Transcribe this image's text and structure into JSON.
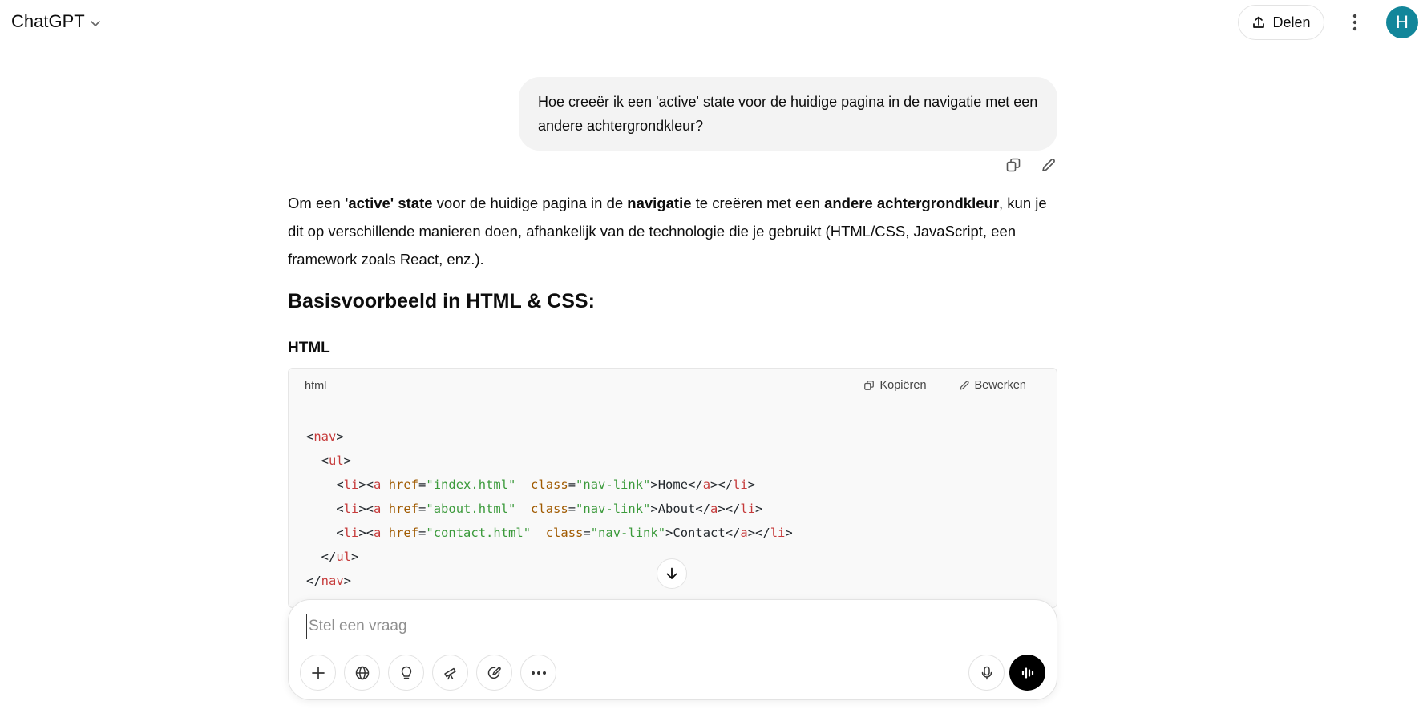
{
  "header": {
    "model_title": "ChatGPT",
    "share_label": "Delen",
    "avatar_initial": "H"
  },
  "user_message": {
    "text": "Hoe creeër ik een 'active' state voor de huidige pagina in de navigatie met een andere achtergrondkleur?"
  },
  "assistant": {
    "intro": {
      "t1": "Om een ",
      "b1": "'active' state",
      "t2": " voor de huidige pagina in de ",
      "b2": "navigatie",
      "t3": " te creëren met een ",
      "b3": "andere achtergrondkleur",
      "t4": ", kun je dit op verschillende manieren doen, afhankelijk van de technologie die je gebruikt (HTML/CSS, JavaScript, een framework zoals React, enz.)."
    },
    "heading": "Basisvoorbeeld in HTML & CSS:",
    "subheading": "HTML",
    "code": {
      "language": "html",
      "copy_label": "Kopiëren",
      "edit_label": "Bewerken",
      "lines": [
        "<nav>",
        "  <ul>",
        "    <li><a href=\"index.html\" class=\"nav-link\">Home</a></li>",
        "    <li><a href=\"about.html\" class=\"nav-link\">About</a></li>",
        "    <li><a href=\"contact.html\" class=\"nav-link\">Contact</a></li>",
        "  </ul>",
        "</nav>"
      ]
    }
  },
  "composer": {
    "placeholder": "Stel een vraag"
  },
  "icons": {
    "tools": [
      "plus-icon",
      "globe-icon",
      "lightbulb-icon",
      "telescope-icon",
      "canvas-icon",
      "more-horizontal-icon"
    ],
    "mic": "mic-icon",
    "voice": "voice-mode-icon"
  },
  "colors": {
    "avatar": "#12869a",
    "tag": "#c63b3b",
    "attribute": "#a05a00",
    "string": "#3b9a3b"
  }
}
